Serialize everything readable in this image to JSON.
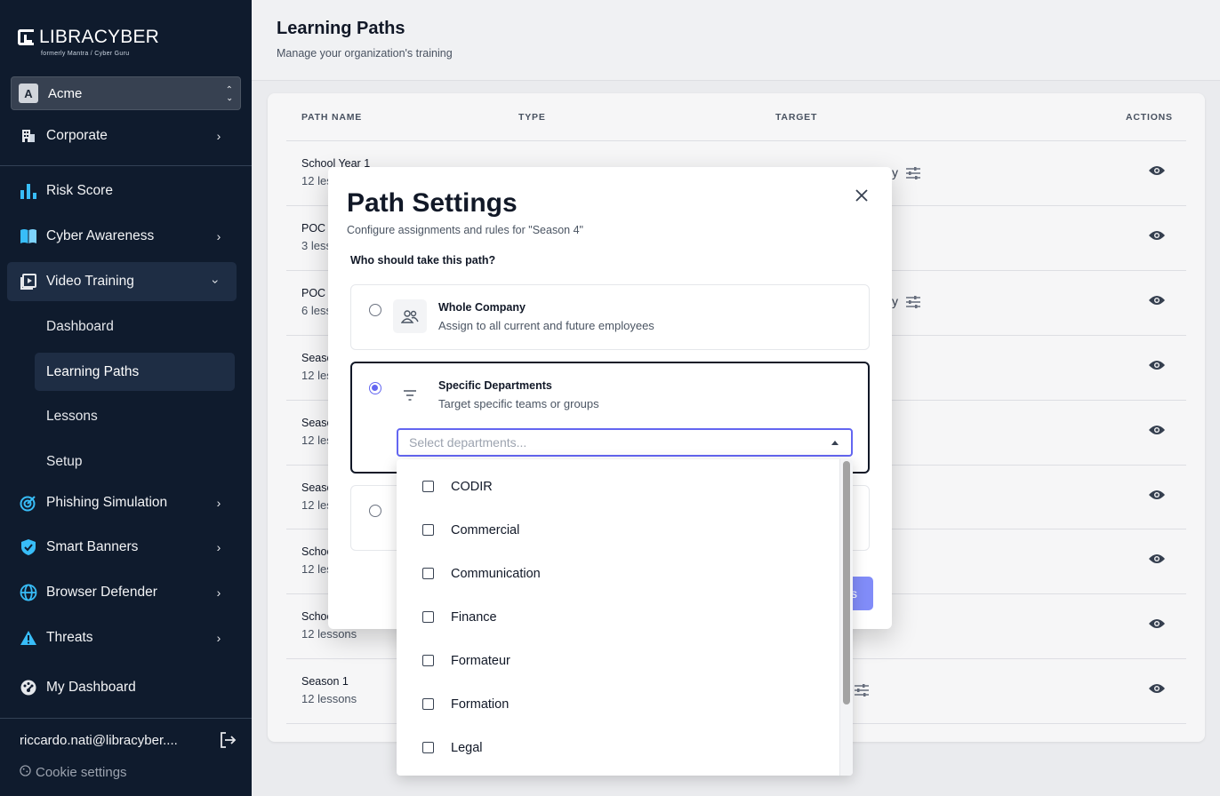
{
  "brand": {
    "name": "LIBRACYBER",
    "sub": "formerly  Mantra  /  Cyber Guru"
  },
  "org": {
    "initial": "A",
    "name": "Acme"
  },
  "nav": {
    "corporate": "Corporate",
    "risk_score": "Risk Score",
    "cyber_awareness": "Cyber Awareness",
    "video_training": "Video Training",
    "sub": {
      "dashboard": "Dashboard",
      "learning_paths": "Learning Paths",
      "lessons": "Lessons",
      "setup": "Setup"
    },
    "phishing": "Phishing Simulation",
    "smart_banners": "Smart Banners",
    "browser_defender": "Browser Defender",
    "threats": "Threats",
    "my_dashboard": "My Dashboard"
  },
  "user": {
    "email": "riccardo.nati@libracyber....",
    "cookie": "Cookie settings"
  },
  "page": {
    "title": "Learning Paths",
    "subtitle": "Manage your organization's training"
  },
  "table": {
    "headers": {
      "name": "PATH NAME",
      "type": "TYPE",
      "target": "TARGET",
      "actions": "ACTIONS"
    },
    "rows": [
      {
        "name": "School Year 1",
        "sub": "12 less"
      },
      {
        "name": "POC C",
        "sub": "3 less"
      },
      {
        "name": "POC A",
        "sub": "6 less"
      },
      {
        "name": "Seaso",
        "sub": "12 less"
      },
      {
        "name": "Seaso",
        "sub": "12 less"
      },
      {
        "name": "Seaso",
        "sub": "12 less"
      },
      {
        "name": "Schoo",
        "sub": "12 les"
      },
      {
        "name": "Schoo",
        "sub": "12 lessons"
      },
      {
        "name": "Season 1",
        "sub": "12 lessons"
      }
    ],
    "target_fragments": [
      "y",
      "y"
    ]
  },
  "modal": {
    "title": "Path Settings",
    "subtitle": "Configure assignments and rules for \"Season 4\"",
    "question": "Who should take this path?",
    "whole": {
      "title": "Whole Company",
      "desc": "Assign to all current and future employees"
    },
    "specific": {
      "title": "Specific Departments",
      "desc": "Target specific teams or groups"
    },
    "dept_placeholder": "Select departments...",
    "save_fragment": "s"
  },
  "departments": [
    "CODIR",
    "Commercial",
    "Communication",
    "Finance",
    "Formateur",
    "Formation",
    "Legal"
  ]
}
